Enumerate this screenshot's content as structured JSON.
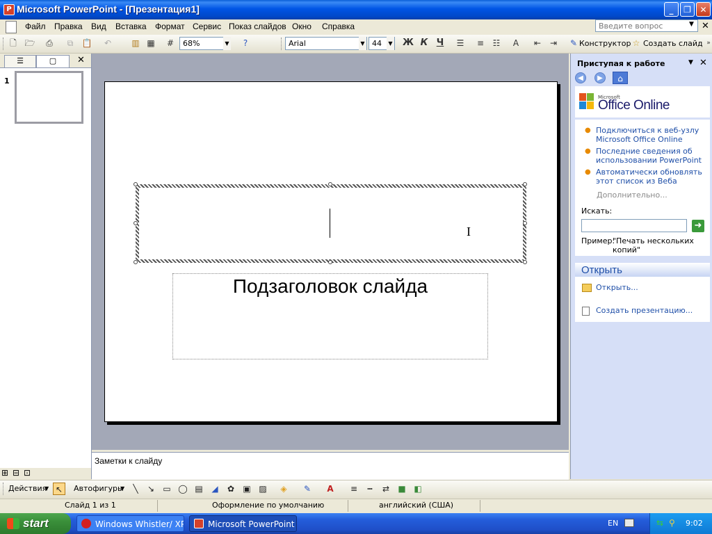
{
  "window": {
    "title": "Microsoft PowerPoint - [Презентация1]",
    "app_icon": "P"
  },
  "menu": {
    "items": [
      "Файл",
      "Правка",
      "Вид",
      "Вставка",
      "Формат",
      "Сервис",
      "Показ слайдов",
      "Окно",
      "Справка"
    ],
    "help_placeholder": "Введите вопрос"
  },
  "toolbar": {
    "zoom": "68%",
    "font": "Arial",
    "font_size": "44",
    "bold": "Ж",
    "italic": "К",
    "underline": "Ч",
    "designer": "Конструктор",
    "new_slide": "Создать слайд"
  },
  "left_pane": {
    "slide_number": "1"
  },
  "slide": {
    "subtitle_placeholder": "Подзаголовок слайда"
  },
  "notes": {
    "placeholder": "Заметки к слайду"
  },
  "task_pane": {
    "title": "Приступая к работе",
    "office_brand_small": "Microsoft",
    "office_brand": "Office Online",
    "links": [
      "Подключиться к веб-узлу Microsoft Office Online",
      "Последние сведения об использовании PowerPoint",
      "Автоматически обновлять этот список из Веба"
    ],
    "more": "Дополнительно...",
    "search_label": "Искать:",
    "example_label": "Пример:",
    "example_text": "\"Печать нескольких копий\"",
    "open_section_title": "Открыть",
    "open_link": "Открыть...",
    "create_link": "Создать презентацию..."
  },
  "drawing_toolbar": {
    "actions": "Действия",
    "autoshapes": "Автофигуры"
  },
  "status_bar": {
    "slide_info": "Слайд 1 из 1",
    "design": "Оформление по умолчанию",
    "language": "английский (США)"
  },
  "taskbar": {
    "start": "start",
    "tasks": [
      "Windows Whistler/ XP...",
      "Microsoft PowerPoint ..."
    ],
    "lang": "EN",
    "clock": "9:02"
  }
}
